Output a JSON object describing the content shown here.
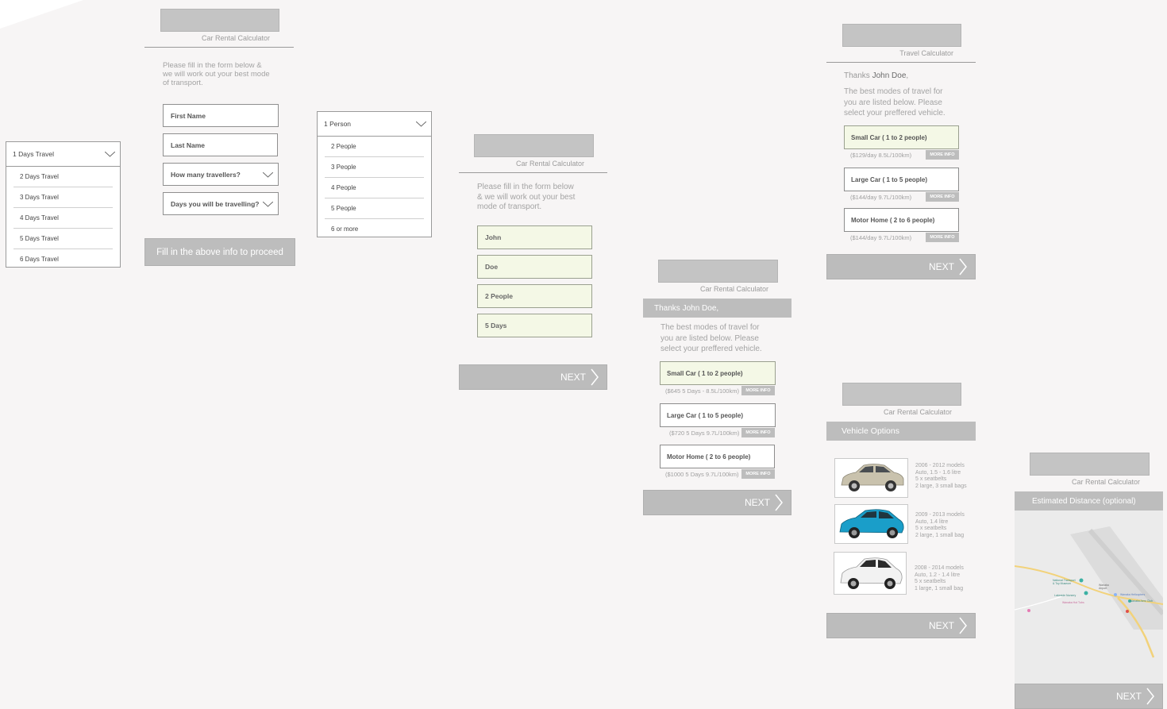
{
  "days_dropdown": {
    "selected": "1 Days Travel",
    "options": [
      "2 Days Travel",
      "3 Days Travel",
      "4 Days Travel",
      "5 Days Travel",
      "6 Days Travel"
    ]
  },
  "screen1": {
    "title": "Car Rental Calculator",
    "intro": [
      "Please fill in the form below &",
      "we will work out your best mode",
      "of transport."
    ],
    "first_name_placeholder": "First Name",
    "last_name_placeholder": "Last Name",
    "travellers_placeholder": "How many travellers?",
    "days_placeholder": "Days you will be travelling?",
    "proceed_label": "Fill in the above info to proceed"
  },
  "people_dropdown": {
    "selected": "1 Person",
    "options": [
      "2 People",
      "3 People",
      "4 People",
      "5 People",
      "6 or more"
    ]
  },
  "screen2": {
    "title": "Car Rental Calculator",
    "intro": [
      "Please fill in the form below",
      "& we will work out your best",
      "mode of transport."
    ],
    "first_name": "John",
    "last_name": "Doe",
    "travellers": "2 People",
    "days": "5 Days",
    "next_label": "NEXT"
  },
  "screen3": {
    "title": "Car Rental Calculator",
    "banner": "Thanks John Doe,",
    "intro": [
      "The best modes of travel for",
      "you are listed below. Please",
      "select your preffered vehicle."
    ],
    "options": [
      {
        "label": "Small Car ( 1 to 2 people)",
        "price": "($645 5 Days - 8.5L/100km)",
        "more": "MORE INFO"
      },
      {
        "label": "Large Car ( 1 to 5 people)",
        "price": "($720 5 Days 9.7L/100km)",
        "more": "MORE INFO"
      },
      {
        "label": "Motor Home ( 2 to 6 people)",
        "price": "($1000 5 Days 9.7L/100km)",
        "more": "MORE INFO"
      }
    ],
    "next_label": "NEXT"
  },
  "screen4": {
    "title": "Travel Calculator",
    "thanks_prefix": "Thanks ",
    "thanks_name": "John Doe",
    "thanks_suffix": ",",
    "intro": [
      "The best modes of travel for",
      "you are listed below. Please",
      "select your preffered vehicle."
    ],
    "options": [
      {
        "label": "Small Car ( 1 to 2 people)",
        "price": "($129/day 8.5L/100km)",
        "more": "MORE INFO"
      },
      {
        "label": "Large Car ( 1 to 5 people)",
        "price": "($144/day 9.7L/100km)",
        "more": "MORE INFO"
      },
      {
        "label": "Motor Home ( 2 to 6 people)",
        "price": "($144/day 9.7L/100km)",
        "more": "MORE INFO"
      }
    ],
    "next_label": "NEXT"
  },
  "screen5": {
    "title": "Car Rental Calculator",
    "banner": "Vehicle Options",
    "vehicles": [
      {
        "color": "#c9c2ad",
        "lines": [
          "2006 - 2012 models",
          "Auto, 1.5 - 1.6 litre",
          "5 x seatbelts",
          "2 large, 3 small bags"
        ]
      },
      {
        "color": "#1a9ec9",
        "lines": [
          "2009 - 2013 models",
          "Auto, 1.4 litre",
          "5 x seatbelts",
          "2 large, 1 small bag"
        ]
      },
      {
        "color": "#f2f2f2",
        "lines": [
          "2008 - 2014 models",
          "Auto, 1.2 - 1.4 litre",
          "5 x seatbelts",
          "1 large, 1 small bag"
        ]
      }
    ],
    "next_label": "NEXT"
  },
  "screen6": {
    "title": "Car Rental Calculator",
    "banner": "Estimated Distance (optional)",
    "map_labels": [
      "National Transport & Toy Museum",
      "Wanaka Airport",
      "Lakeside Nursery",
      "Wanaka Helicopters",
      "Wanaka Hot Tubs",
      "Wanaka Aero Club"
    ],
    "next_label": "NEXT"
  }
}
